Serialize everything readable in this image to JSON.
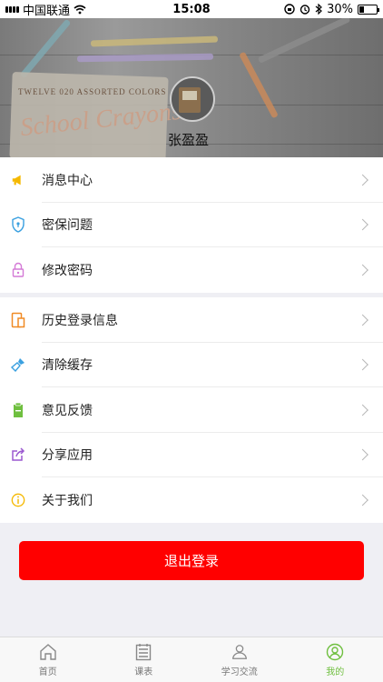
{
  "status_bar": {
    "carrier": "中国联通",
    "time": "15:08",
    "battery": "30%",
    "battery_level": 0.3
  },
  "profile": {
    "username": "张盈盈",
    "box_text_top": "TWELVE 020 ASSORTED COLORS",
    "box_text_main": "School Crayons"
  },
  "menu_group_1": [
    {
      "label": "消息中心",
      "icon": "megaphone-icon",
      "color": "#f5b800"
    },
    {
      "label": "密保问题",
      "icon": "shield-icon",
      "color": "#3aa0e0"
    },
    {
      "label": "修改密码",
      "icon": "lock-icon",
      "color": "#d47ad6"
    }
  ],
  "menu_group_2": [
    {
      "label": "历史登录信息",
      "icon": "history-icon",
      "color": "#f08a24"
    },
    {
      "label": "清除缓存",
      "icon": "broom-icon",
      "color": "#3aa0e0"
    },
    {
      "label": "意见反馈",
      "icon": "feedback-icon",
      "color": "#6fbf3f"
    },
    {
      "label": "分享应用",
      "icon": "share-icon",
      "color": "#9b59d0"
    },
    {
      "label": "关于我们",
      "icon": "info-icon",
      "color": "#f5b800"
    }
  ],
  "logout_label": "退出登录",
  "tabs": [
    {
      "label": "首页",
      "icon": "home-icon"
    },
    {
      "label": "课表",
      "icon": "schedule-icon"
    },
    {
      "label": "学习交流",
      "icon": "community-icon"
    },
    {
      "label": "我的",
      "icon": "profile-icon",
      "active": true
    }
  ],
  "colors": {
    "accent": "#6fbf3f",
    "logout": "#ff0000"
  }
}
